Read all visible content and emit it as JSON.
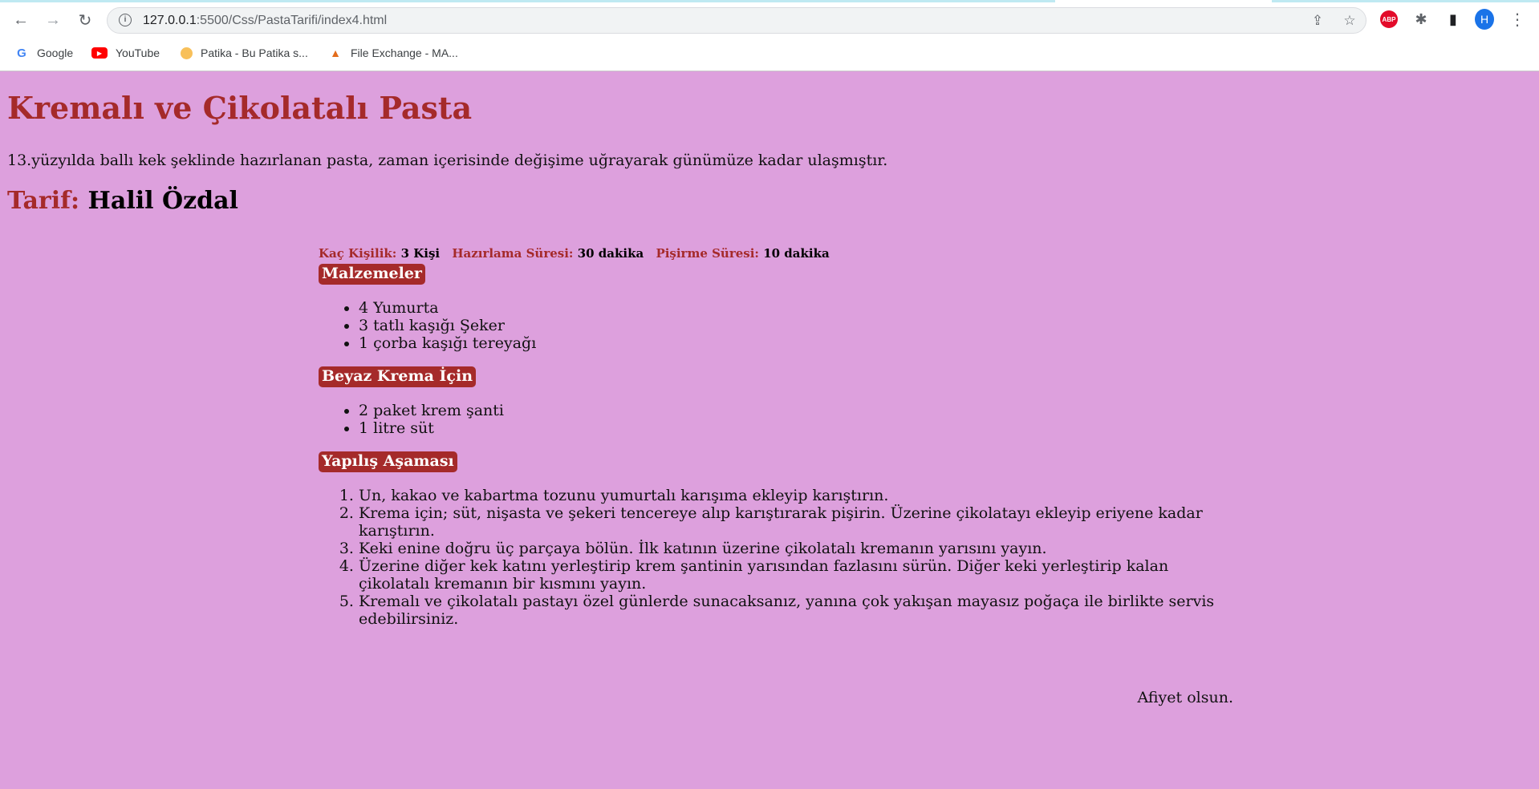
{
  "browser": {
    "url_host": "127.0.0.1",
    "url_path": ":5500/Css/PastaTarifi/index4.html",
    "back_icon": "←",
    "forward_icon": "→",
    "reload_icon": "↻",
    "share_icon": "⇪",
    "star_icon": "☆",
    "abp_label": "ABP",
    "puzzle_icon": "✱",
    "panel_icon": "▮",
    "avatar_letter": "H",
    "menu_icon": "⋮",
    "bookmarks": [
      {
        "label": "Google",
        "icon": "G"
      },
      {
        "label": "YouTube",
        "icon": "▶"
      },
      {
        "label": "Patika - Bu Patika s...",
        "icon": ""
      },
      {
        "label": "File Exchange - MA...",
        "icon": "▲"
      }
    ]
  },
  "recipe": {
    "title": "Kremalı ve Çikolatalı Pasta",
    "intro": "13.yüzyılda ballı kek şeklinde hazırlanan pasta, zaman içerisinde değişime uğrayarak günümüze kadar ulaşmıştır.",
    "author_label": "Tarif:",
    "author_name": "Halil Özdal",
    "meta": {
      "servings_label": "Kaç Kişilik:",
      "servings_value": "3 Kişi",
      "prep_label": "Hazırlama Süresi:",
      "prep_value": "30 dakika",
      "cook_label": "Pişirme Süresi:",
      "cook_value": "10 dakika"
    },
    "sections": {
      "ingredients_title": "Malzemeler",
      "ingredients": [
        "4 Yumurta",
        "3 tatlı kaşığı Şeker",
        "1 çorba kaşığı tereyağı"
      ],
      "cream_title": "Beyaz Krema İçin",
      "cream": [
        "2 paket krem şanti",
        "1 litre süt"
      ],
      "steps_title": "Yapılış Aşaması",
      "steps": [
        "Un, kakao ve kabartma tozunu yumurtalı karışıma ekleyip karıştırın.",
        "Krema için; süt, nişasta ve şekeri tencereye alıp karıştırarak pişirin. Üzerine çikolatayı ekleyip eriyene kadar karıştırın.",
        "Keki enine doğru üç parçaya bölün. İlk katının üzerine çikolatalı kremanın yarısını yayın.",
        "Üzerine diğer kek katını yerleştirip krem şantinin yarısından fazlasını sürün. Diğer keki yerleştirip kalan çikolatalı kremanın bir kısmını yayın.",
        "Kremalı ve çikolatalı pastayı özel günlerde sunacaksanız, yanına çok yakışan mayasız poğaça ile birlikte servis edebilirsiniz."
      ]
    },
    "closing": "Afiyet olsun."
  }
}
